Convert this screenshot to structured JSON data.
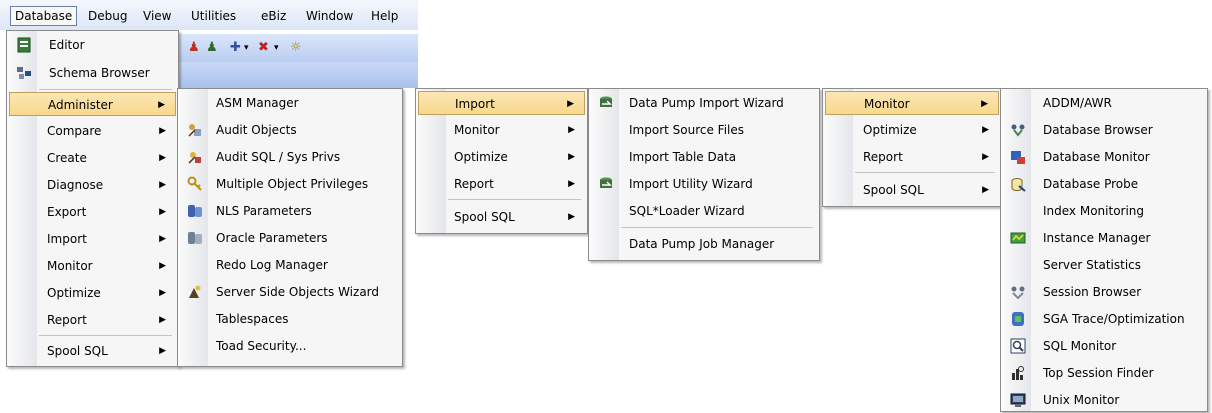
{
  "menubar": {
    "items": [
      "Database",
      "Debug",
      "View",
      "Utilities",
      "eBiz",
      "Window",
      "Help"
    ],
    "active": "Database"
  },
  "database_menu": {
    "items": [
      {
        "label": "Editor",
        "icon": "editor-icon",
        "submenu": false
      },
      {
        "label": "Schema Browser",
        "icon": "schema-browser-icon",
        "submenu": false
      },
      {
        "label": "Administer",
        "icon": "",
        "submenu": true,
        "highlighted": true
      },
      {
        "label": "Compare",
        "icon": "",
        "submenu": true
      },
      {
        "label": "Create",
        "icon": "",
        "submenu": true
      },
      {
        "label": "Diagnose",
        "icon": "",
        "submenu": true
      },
      {
        "label": "Export",
        "icon": "",
        "submenu": true
      },
      {
        "label": "Import",
        "icon": "",
        "submenu": true
      },
      {
        "label": "Monitor",
        "icon": "",
        "submenu": true
      },
      {
        "label": "Optimize",
        "icon": "",
        "submenu": true
      },
      {
        "label": "Report",
        "icon": "",
        "submenu": true
      },
      {
        "label": "Spool SQL",
        "icon": "",
        "submenu": true
      }
    ]
  },
  "administer_menu": {
    "items": [
      {
        "label": "ASM Manager",
        "icon": ""
      },
      {
        "label": "Audit Objects",
        "icon": "audit-objects-icon"
      },
      {
        "label": "Audit SQL / Sys Privs",
        "icon": "audit-sql-icon"
      },
      {
        "label": "Multiple Object Privileges",
        "icon": "key-icon"
      },
      {
        "label": "NLS Parameters",
        "icon": "nls-parameters-icon"
      },
      {
        "label": "Oracle Parameters",
        "icon": "oracle-parameters-icon"
      },
      {
        "label": "Redo Log Manager",
        "icon": ""
      },
      {
        "label": "Server Side Objects Wizard",
        "icon": "wizard-icon"
      },
      {
        "label": "Tablespaces",
        "icon": ""
      },
      {
        "label": "Toad Security...",
        "icon": ""
      }
    ]
  },
  "import_parent_menu": {
    "items": [
      {
        "label": "Import",
        "submenu": true,
        "highlighted": true
      },
      {
        "label": "Monitor",
        "submenu": true
      },
      {
        "label": "Optimize",
        "submenu": true
      },
      {
        "label": "Report",
        "submenu": true
      },
      {
        "label": "Spool SQL",
        "submenu": true
      }
    ]
  },
  "import_menu": {
    "items": [
      {
        "label": "Data Pump Import Wizard",
        "icon": "data-pump-icon"
      },
      {
        "label": "Import Source Files",
        "icon": ""
      },
      {
        "label": "Import Table Data",
        "icon": ""
      },
      {
        "label": "Import Utility Wizard",
        "icon": "import-utility-icon"
      },
      {
        "label": "SQL*Loader Wizard",
        "icon": ""
      },
      {
        "label": "Data Pump Job Manager",
        "icon": ""
      }
    ]
  },
  "monitor_parent_menu": {
    "items": [
      {
        "label": "Monitor",
        "submenu": true,
        "highlighted": true
      },
      {
        "label": "Optimize",
        "submenu": true
      },
      {
        "label": "Report",
        "submenu": true
      },
      {
        "label": "Spool SQL",
        "submenu": true
      }
    ]
  },
  "monitor_menu": {
    "items": [
      {
        "label": "ADDM/AWR",
        "icon": ""
      },
      {
        "label": "Database Browser",
        "icon": "database-browser-icon"
      },
      {
        "label": "Database Monitor",
        "icon": "database-monitor-icon"
      },
      {
        "label": "Database Probe",
        "icon": "database-probe-icon"
      },
      {
        "label": "Index Monitoring",
        "icon": ""
      },
      {
        "label": "Instance Manager",
        "icon": "instance-manager-icon"
      },
      {
        "label": "Server Statistics",
        "icon": ""
      },
      {
        "label": "Session Browser",
        "icon": "session-browser-icon"
      },
      {
        "label": "SGA Trace/Optimization",
        "icon": "sga-trace-icon"
      },
      {
        "label": "SQL Monitor",
        "icon": "sql-monitor-icon"
      },
      {
        "label": "Top Session Finder",
        "icon": "top-session-finder-icon"
      },
      {
        "label": "Unix Monitor",
        "icon": "unix-monitor-icon"
      }
    ]
  },
  "colors": {
    "highlight": "#f8d88d",
    "menubar": "#dde6f6",
    "menu_bg": "#f6f6f6"
  }
}
